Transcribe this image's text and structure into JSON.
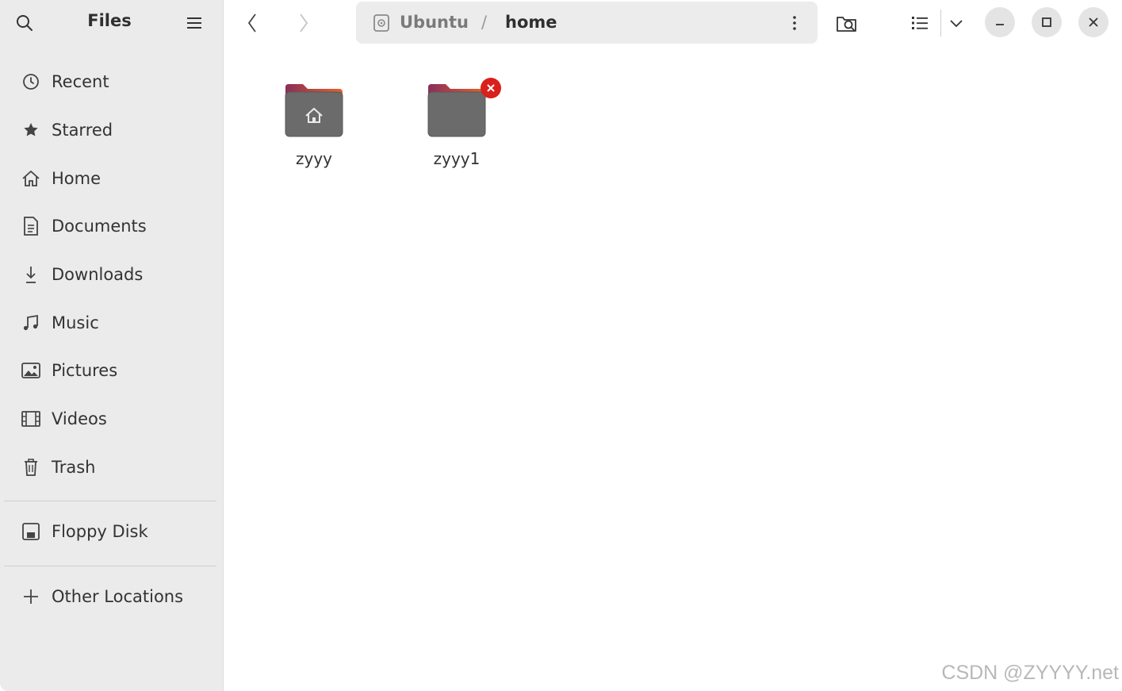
{
  "sidebar": {
    "title": "Files",
    "items": [
      {
        "label": "Recent",
        "icon": "clock-icon"
      },
      {
        "label": "Starred",
        "icon": "star-icon"
      },
      {
        "label": "Home",
        "icon": "home-icon"
      },
      {
        "label": "Documents",
        "icon": "document-icon"
      },
      {
        "label": "Downloads",
        "icon": "download-icon"
      },
      {
        "label": "Music",
        "icon": "music-icon"
      },
      {
        "label": "Pictures",
        "icon": "picture-icon"
      },
      {
        "label": "Videos",
        "icon": "video-icon"
      },
      {
        "label": "Trash",
        "icon": "trash-icon"
      }
    ],
    "devices": [
      {
        "label": "Floppy Disk",
        "icon": "floppy-icon"
      }
    ],
    "other": {
      "label": "Other Locations",
      "icon": "plus-icon"
    }
  },
  "pathbar": {
    "segments": [
      "Ubuntu",
      "home"
    ],
    "separator": "/"
  },
  "files": [
    {
      "name": "zyyy",
      "type": "home-folder"
    },
    {
      "name": "zyyy1",
      "type": "folder",
      "badge": "error"
    }
  ],
  "colors": {
    "accent": "#e95420",
    "folder_body": "#6b6b6b",
    "folder_tab": "#8a2f5a",
    "error_badge": "#d9201b",
    "sidebar_bg": "#ebebeb"
  },
  "watermark": "CSDN @ZYYYY.net"
}
